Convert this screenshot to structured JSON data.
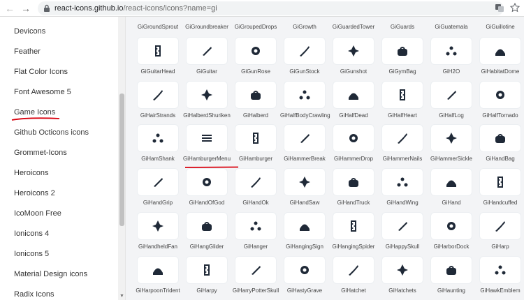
{
  "browser": {
    "url_host": "react-icons.github.io",
    "url_path": "/react-icons/icons?name=gi"
  },
  "sidebar": {
    "items": [
      "Devicons",
      "Feather",
      "Flat Color Icons",
      "Font Awesome 5",
      "Game Icons",
      "Github Octicons icons",
      "Grommet-Icons",
      "Heroicons",
      "Heroicons 2",
      "IcoMoon Free",
      "Ionicons 4",
      "Ionicons 5",
      "Material Design icons",
      "Radix Icons"
    ]
  },
  "grid": {
    "top_labels": [
      "GiGroundSprout",
      "GiGroundbreaker",
      "GiGroupedDrops",
      "GiGrowth",
      "GiGuardedTower",
      "GiGuards",
      "GiGuatemala",
      "GiGuillotine"
    ],
    "rows": [
      [
        "GiGuitarHead",
        "GiGuitar",
        "GiGunRose",
        "GiGunStock",
        "GiGunshot",
        "GiGymBag",
        "GiH2O",
        "GiHabitatDome"
      ],
      [
        "GiHairStrands",
        "GiHalberdShuriken",
        "GiHalberd",
        "GiHalfBodyCrawling",
        "GiHalfDead",
        "GiHalfHeart",
        "GiHalfLog",
        "GiHalfTornado"
      ],
      [
        "GiHamShank",
        "GiHamburgerMenu",
        "GiHamburger",
        "GiHammerBreak",
        "GiHammerDrop",
        "GiHammerNails",
        "GiHammerSickle",
        "GiHandBag"
      ],
      [
        "GiHandGrip",
        "GiHandOfGod",
        "GiHandOk",
        "GiHandSaw",
        "GiHandTruck",
        "GiHandWing",
        "GiHand",
        "GiHandcuffed"
      ],
      [
        "GiHandheldFan",
        "GiHangGlider",
        "GiHanger",
        "GiHangingSign",
        "GiHangingSpider",
        "GiHappySkull",
        "GiHarborDock",
        "GiHarp"
      ],
      [
        "GiHarpoonTrident",
        "GiHarpy",
        "GiHarryPotterSkull",
        "GiHastyGrave",
        "GiHatchet",
        "GiHatchets",
        "GiHaunting",
        "GiHawkEmblem"
      ]
    ]
  },
  "colors": {
    "annotation": "#d9000d",
    "icon": "#1f2937"
  }
}
